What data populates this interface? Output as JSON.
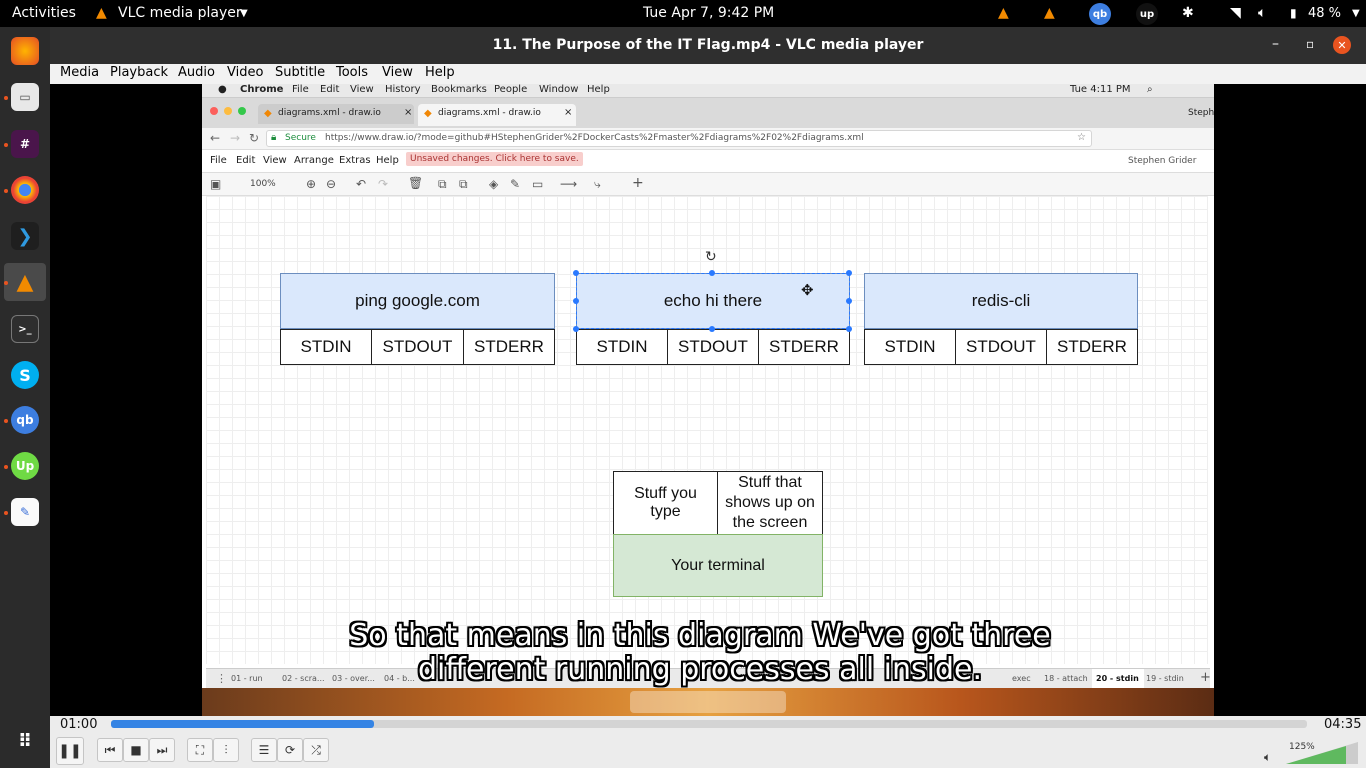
{
  "topbar": {
    "activities": "Activities",
    "app_name": "VLC media player",
    "clock": "Tue Apr  7,  9:42 PM",
    "battery": "48 %"
  },
  "vlc": {
    "window_title": "11. The Purpose of the IT Flag.mp4 - VLC media player",
    "menu": [
      "Media",
      "Playback",
      "Audio",
      "Video",
      "Subtitle",
      "Tools",
      "View",
      "Help"
    ],
    "elapsed": "01:00",
    "total": "04:35",
    "progress": 0.22,
    "volume": "125%",
    "subtitle_line1": "So that means in this diagram We've got three",
    "subtitle_line2": "different running processes all inside."
  },
  "mac": {
    "menubar": {
      "app": "Chrome",
      "items": [
        "File",
        "Edit",
        "View",
        "History",
        "Bookmarks",
        "People",
        "Window",
        "Help"
      ],
      "clock": "Tue 4:11 PM",
      "user": "Stephen"
    },
    "tabs": [
      {
        "label": "diagrams.xml - draw.io"
      },
      {
        "label": "diagrams.xml - draw.io"
      }
    ],
    "secure": "Secure",
    "url": "https://www.draw.io/?mode=github#HStephenGrider%2FDockerCasts%2Fmaster%2Fdiagrams%2F02%2Fdiagrams.xml",
    "drawio_menu": [
      "File",
      "Edit",
      "View",
      "Arrange",
      "Extras",
      "Help"
    ],
    "unsaved": "Unsaved changes. Click here to save.",
    "drawio_user": "Stephen Grider",
    "zoom": "100%",
    "page_tabs": [
      "01 - run",
      "02 - scra...",
      "03 - over...",
      "04 - b...",
      "exec",
      "18 - attach",
      "20 - stdin",
      "19 - stdin"
    ]
  },
  "diagram": {
    "processes": [
      {
        "name": "ping google.com",
        "streams": [
          "STDIN",
          "STDOUT",
          "STDERR"
        ]
      },
      {
        "name": "echo hi there",
        "streams": [
          "STDIN",
          "STDOUT",
          "STDERR"
        ]
      },
      {
        "name": "redis-cli",
        "streams": [
          "STDIN",
          "STDOUT",
          "STDERR"
        ]
      }
    ],
    "terminal": {
      "type_label": "Stuff you type",
      "screen_label": "Stuff that shows up on the screen",
      "name": "Your terminal"
    }
  },
  "colors": {
    "accent_blue": "#2979ff",
    "process_fill": "#dae8fc",
    "terminal_fill": "#d5e8d4",
    "seek_fill": "#3584e4"
  }
}
